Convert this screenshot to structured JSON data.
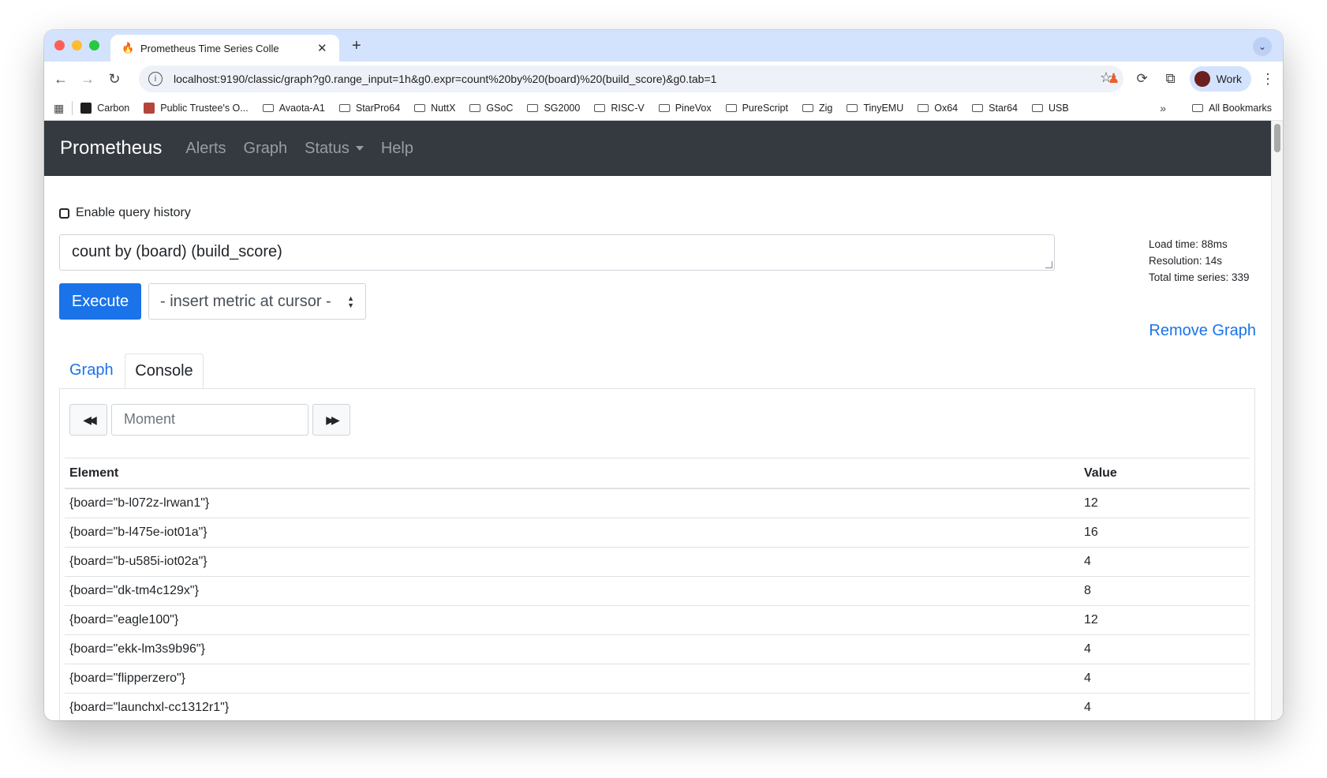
{
  "browser": {
    "tab_title": "Prometheus Time Series Colle",
    "url": "localhost:9190/classic/graph?g0.range_input=1h&g0.expr=count%20by%20(board)%20(build_score)&g0.tab=1",
    "profile_label": "Work",
    "bookmarks": [
      "Carbon",
      "Public Trustee's O...",
      "Avaota-A1",
      "StarPro64",
      "NuttX",
      "GSoC",
      "SG2000",
      "RISC-V",
      "PineVox",
      "PureScript",
      "Zig",
      "TinyEMU",
      "Ox64",
      "Star64",
      "USB"
    ],
    "all_bookmarks": "All Bookmarks",
    "more_bookmarks": "»"
  },
  "navbar": {
    "brand": "Prometheus",
    "links": [
      "Alerts",
      "Graph",
      "Status",
      "Help"
    ]
  },
  "query": {
    "history_label": "Enable query history",
    "expression": "count by (board) (build_score)",
    "execute_label": "Execute",
    "metric_select": "- insert metric at cursor -"
  },
  "stats": {
    "load_time": "Load time: 88ms",
    "resolution": "Resolution: 14s",
    "total_series": "Total time series: 339"
  },
  "remove_graph": "Remove Graph",
  "tabs": [
    "Graph",
    "Console"
  ],
  "console": {
    "moment_placeholder": "Moment",
    "columns": [
      "Element",
      "Value"
    ],
    "rows": [
      {
        "element": "{board=\"b-l072z-lrwan1\"}",
        "value": "12"
      },
      {
        "element": "{board=\"b-l475e-iot01a\"}",
        "value": "16"
      },
      {
        "element": "{board=\"b-u585i-iot02a\"}",
        "value": "4"
      },
      {
        "element": "{board=\"dk-tm4c129x\"}",
        "value": "8"
      },
      {
        "element": "{board=\"eagle100\"}",
        "value": "12"
      },
      {
        "element": "{board=\"ekk-lm3s9b96\"}",
        "value": "4"
      },
      {
        "element": "{board=\"flipperzero\"}",
        "value": "4"
      },
      {
        "element": "{board=\"launchxl-cc1312r1\"}",
        "value": "4"
      }
    ]
  }
}
